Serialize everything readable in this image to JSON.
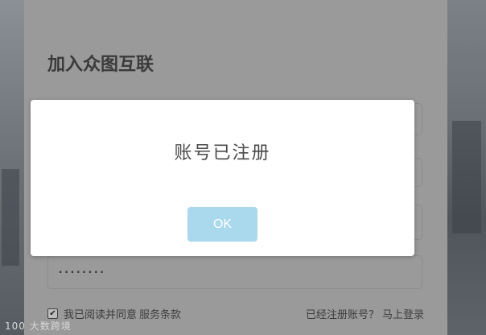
{
  "form": {
    "title": "加入众图互联",
    "password_masked": "········"
  },
  "agreement": {
    "checked_mark": "✔",
    "text": "我已阅读并同意",
    "terms_link": "服务条款"
  },
  "login": {
    "question": "已经注册账号？",
    "link": "马上登录"
  },
  "dialog": {
    "message": "账号已注册",
    "ok_label": "OK"
  },
  "watermark": {
    "text": "100 大数跨境"
  },
  "colors": {
    "ok_button": "#aad9ee",
    "dialog_bg": "#ffffff",
    "overlay_panel": "#9a9a9a"
  }
}
